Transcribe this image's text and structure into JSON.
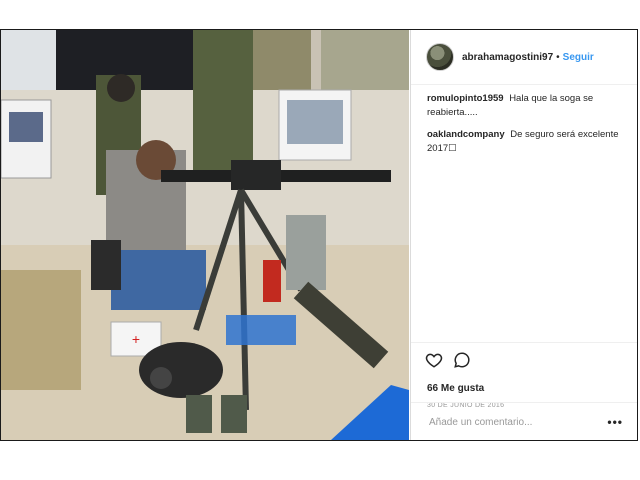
{
  "post": {
    "username": "abrahamagostini97",
    "separator": "•",
    "follow_label": "Seguir",
    "comments": [
      {
        "user": "romulopinto1959",
        "text": "Hala que la soga se reabierta....."
      },
      {
        "user": "oaklandcompany",
        "text": "De seguro será excelente 2017☐"
      }
    ],
    "likes": "66 Me gusta",
    "date": "30 DE JUNIO DE 2016",
    "comment_placeholder": "Añade un comentario...",
    "more_label": "•••"
  }
}
